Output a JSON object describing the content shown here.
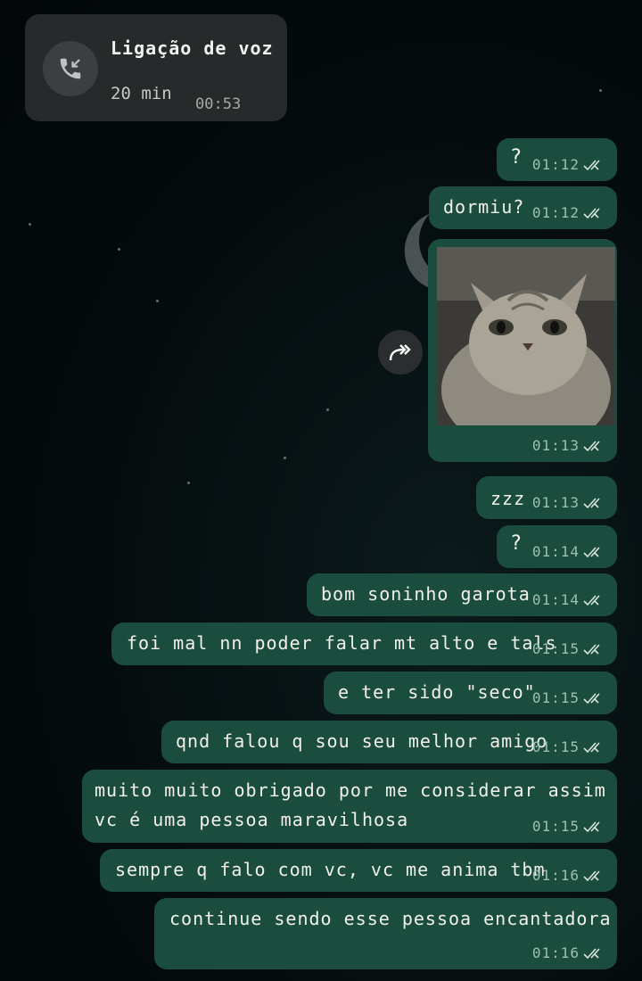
{
  "call": {
    "title": "Ligação de voz",
    "duration": "20 min",
    "time": "00:53",
    "icon": "incoming-call-icon"
  },
  "messages": [
    {
      "text": "?",
      "time": "01:12",
      "status": "read"
    },
    {
      "text": "dormiu?",
      "time": "01:12",
      "status": "read"
    },
    {
      "type": "image",
      "time": "01:13",
      "status": "read",
      "image": "cat-photo"
    },
    {
      "text": "zzz",
      "time": "01:13",
      "status": "read"
    },
    {
      "text": "?",
      "time": "01:14",
      "status": "read"
    },
    {
      "text": "bom soninho garota",
      "time": "01:14",
      "status": "read"
    },
    {
      "text": "foi mal nn poder falar mt alto e tals",
      "time": "01:15",
      "status": "read"
    },
    {
      "text": "e ter sido \"seco\"",
      "time": "01:15",
      "status": "read"
    },
    {
      "text": "qnd falou q sou seu melhor amigo",
      "time": "01:15",
      "status": "read"
    },
    {
      "line1": "muito muito obrigado por me considerar assim",
      "line2": "vc é uma pessoa maravilhosa",
      "time": "01:15",
      "status": "read"
    },
    {
      "text": "sempre q falo com vc, vc me anima tbm",
      "time": "01:16",
      "status": "read"
    },
    {
      "text": "continue sendo esse pessoa encantadora",
      "time": "01:16",
      "status": "read"
    }
  ],
  "colors": {
    "outgoing_bubble": "#1b4d3e",
    "call_card": "#262a2b",
    "read_ticks": "#9fbfb3"
  }
}
